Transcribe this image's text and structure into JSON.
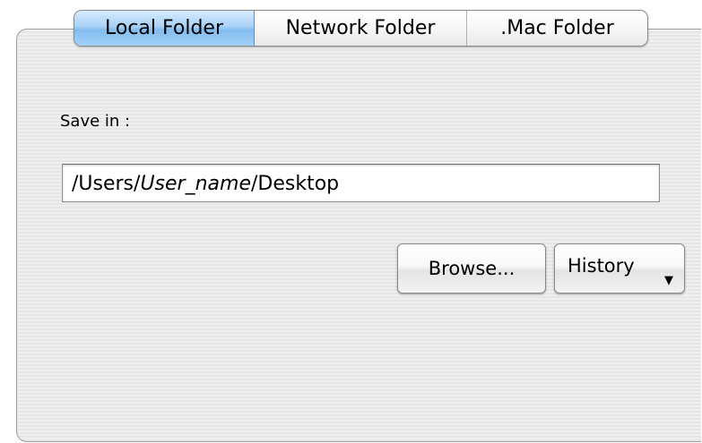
{
  "tabs": [
    {
      "label": "Local Folder",
      "selected": true
    },
    {
      "label": "Network Folder",
      "selected": false
    },
    {
      "label": ".Mac Folder",
      "selected": false
    }
  ],
  "save_in": {
    "label": "Save in :",
    "path_prefix": "/Users/",
    "path_variable": "User_name",
    "path_suffix": "/Desktop"
  },
  "buttons": {
    "browse_label": "Browse...",
    "history_label": "History",
    "history_icon": "dropdown-arrow-icon"
  },
  "colors": {
    "selected_tab": "#a9d1f5",
    "panel_background": "#ececec"
  }
}
